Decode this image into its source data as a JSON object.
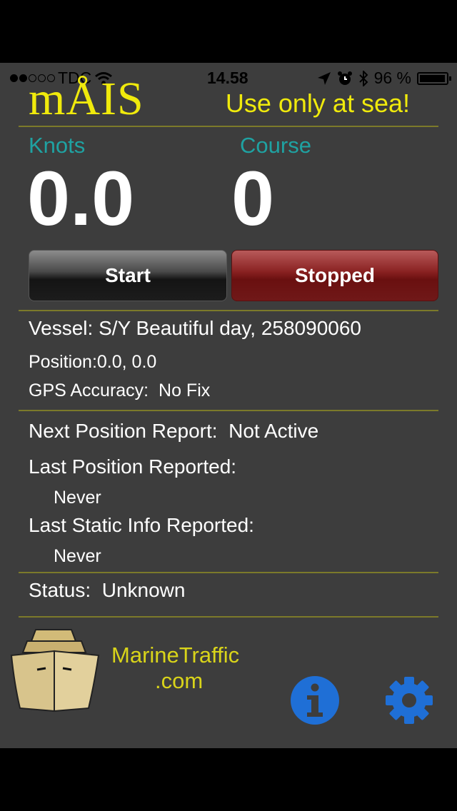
{
  "status_bar": {
    "carrier": "TDC",
    "time": "14.58",
    "battery": "96 %",
    "battery_level": 0.96
  },
  "header": {
    "app_name": "mÅIS",
    "tagline": "Use only at sea!"
  },
  "readouts": {
    "knots_label": "Knots",
    "knots_value": "0.0",
    "course_label": "Course",
    "course_value": "0"
  },
  "controls": {
    "start_label": "Start",
    "stop_label": "Stopped"
  },
  "vessel": {
    "label": "Vessel:",
    "value": "S/Y Beautiful day, 258090060",
    "position_label": "Position:",
    "position_value": "0.0, 0.0",
    "gps_label": "GPS Accuracy:",
    "gps_value": "No Fix"
  },
  "reports": {
    "next_label": "Next Position Report:",
    "next_value": "Not Active",
    "last_pos_label": "Last Position Reported:",
    "last_pos_value": "Never",
    "last_static_label": "Last Static Info Reported:",
    "last_static_value": "Never"
  },
  "status": {
    "label": "Status:",
    "value": "Unknown"
  },
  "footer": {
    "brand_line1": "MarineTraffic",
    "brand_line2": ".com",
    "info_icon": "info-icon",
    "settings_icon": "gear-icon"
  },
  "colors": {
    "accent_yellow": "#f0ea0c",
    "label_teal": "#1fa2a2",
    "stop_red": "#8a2222",
    "icon_blue": "#1f6fd6"
  }
}
